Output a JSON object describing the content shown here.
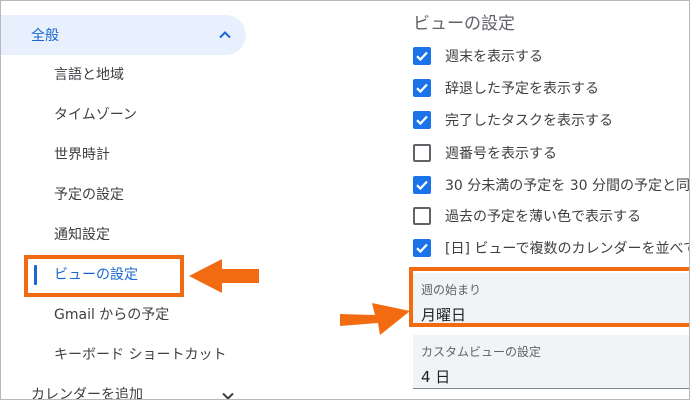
{
  "sidebar": {
    "general": {
      "label": "全般"
    },
    "items": [
      {
        "label": "言語と地域"
      },
      {
        "label": "タイムゾーン"
      },
      {
        "label": "世界時計"
      },
      {
        "label": "予定の設定"
      },
      {
        "label": "通知設定"
      },
      {
        "label": "ビューの設定"
      },
      {
        "label": "Gmail からの予定"
      },
      {
        "label": "キーボード ショートカット"
      }
    ],
    "active_item": "ビューの設定",
    "add_calendar": {
      "label": "カレンダーを追加"
    }
  },
  "view_settings": {
    "title": "ビューの設定",
    "options": [
      {
        "label": "週末を表示する",
        "checked": true
      },
      {
        "label": "辞退した予定を表示する",
        "checked": true
      },
      {
        "label": "完了したタスクを表示する",
        "checked": true
      },
      {
        "label": "週番号を表示する",
        "checked": false
      },
      {
        "label": "30 分未満の予定を 30 分間の予定と同じ",
        "checked": true
      },
      {
        "label": "過去の予定を薄い色で表示する",
        "checked": false
      },
      {
        "label": "[日] ビューで複数のカレンダーを並べて",
        "checked": true
      }
    ],
    "week_start": {
      "label": "週の始まり",
      "value": "月曜日"
    },
    "custom_view": {
      "label": "カスタムビューの設定",
      "value": "4 日"
    }
  },
  "colors": {
    "accent": "#1a73e8",
    "active_text": "#1967d2",
    "nav_active_bg": "#e8f0fe",
    "annotation_orange": "#f36b10"
  },
  "icons": {
    "general_chevron": "chevron-up-icon",
    "add_calendar_chevron": "chevron-down-icon",
    "checkbox_checked": "check-icon",
    "annotation_arrows": "arrow-icon"
  }
}
